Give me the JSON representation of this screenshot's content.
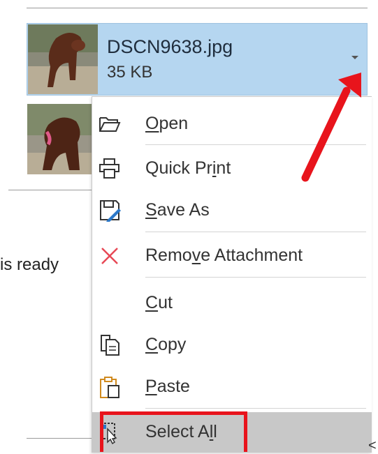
{
  "attachments": [
    {
      "file_name": "DSCN9638.jpg",
      "file_size": "35 KB",
      "selected": true
    },
    {
      "file_name": "",
      "file_size": ""
    }
  ],
  "message_body": {
    "visible_text": "is ready"
  },
  "context_menu": {
    "items": [
      {
        "pre": "",
        "mnemonic": "O",
        "post": "pen",
        "icon": "open-folder-icon"
      },
      {
        "pre": "Quick Pr",
        "mnemonic": "i",
        "post": "nt",
        "icon": "printer-icon"
      },
      {
        "pre": "",
        "mnemonic": "S",
        "post": "ave As",
        "icon": "save-as-icon"
      },
      {
        "pre": "Remo",
        "mnemonic": "v",
        "post": "e Attachment",
        "icon": "remove-x-icon"
      },
      {
        "pre": "",
        "mnemonic": "C",
        "post": "ut",
        "icon": ""
      },
      {
        "pre": "",
        "mnemonic": "C",
        "post": "opy",
        "icon": "copy-icon"
      },
      {
        "pre": "",
        "mnemonic": "P",
        "post": "aste",
        "icon": "paste-icon"
      },
      {
        "pre": "Select A",
        "mnemonic": "l",
        "post": "l",
        "icon": "select-all-icon"
      }
    ],
    "highlighted_item": "Select All"
  },
  "colors": {
    "selection_blue": "#b5d6f0",
    "menu_hover_gray": "#c8c8c8",
    "annotation_red": "#e8141c",
    "remove_icon_red": "#e74856"
  },
  "edge_glyph": "<"
}
